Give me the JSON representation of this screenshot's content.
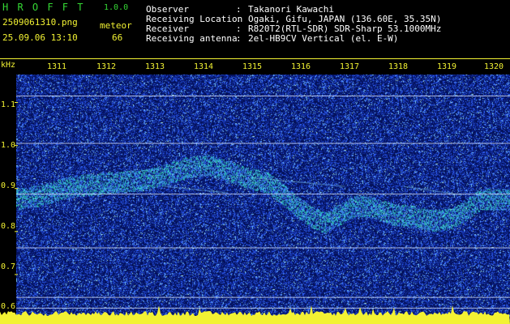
{
  "app": {
    "name": "H R O F F T",
    "version": "1.0.0",
    "filename": "2509061310.png",
    "datetime": "25.09.06 13:10",
    "meteor_label": "meteor",
    "meteor_count": "66"
  },
  "info": [
    {
      "label": "Observer",
      "value": "Takanori Kawachi"
    },
    {
      "label": "Receiving Location",
      "value": "Ogaki, Gifu, JAPAN (136.60E, 35.35N)"
    },
    {
      "label": "Receiver",
      "value": "R820T2(RTL-SDR) SDR-Sharp 53.1000MHz"
    },
    {
      "label": "Receiving antenna",
      "value": "2el-HB9CV Vertical (el. E-W)"
    }
  ],
  "colors": {
    "header_green": "#35d835",
    "label_yellow": "#f2f233",
    "background_blue": "#04115a",
    "noise_blue": "#3a66ff",
    "signal_cyan": "#39e6d8",
    "band_white": "#dfe9ff"
  },
  "chart_data": {
    "type": "heatmap",
    "ylabel": "kHz",
    "x_ticks": [
      "1311",
      "1312",
      "1313",
      "1314",
      "1315",
      "1316",
      "1317",
      "1318",
      "1319",
      "1320"
    ],
    "y_ticks": [
      "1.1",
      "1.0",
      "0.9",
      "0.8",
      "0.7",
      "0.6"
    ],
    "y_range": [
      0.585,
      1.165
    ],
    "horizontal_lines_khz": [
      1.115,
      1.005,
      0.887,
      0.762,
      0.647,
      0.622
    ],
    "signal_trace": {
      "x": [
        1310.7,
        1311.2,
        1311.8,
        1312.3,
        1312.8,
        1313.3,
        1313.8,
        1314.2,
        1314.6,
        1315.0,
        1315.4,
        1315.8,
        1316.1,
        1316.4,
        1316.7,
        1317.0,
        1317.3,
        1317.6,
        1318.0,
        1318.4,
        1318.8,
        1319.2,
        1319.6,
        1320.0,
        1320.2
      ],
      "y": [
        0.875,
        0.885,
        0.905,
        0.91,
        0.915,
        0.92,
        0.935,
        0.95,
        0.955,
        0.94,
        0.925,
        0.915,
        0.89,
        0.86,
        0.835,
        0.82,
        0.84,
        0.86,
        0.855,
        0.84,
        0.835,
        0.825,
        0.83,
        0.86,
        0.875
      ]
    },
    "grid": false
  }
}
